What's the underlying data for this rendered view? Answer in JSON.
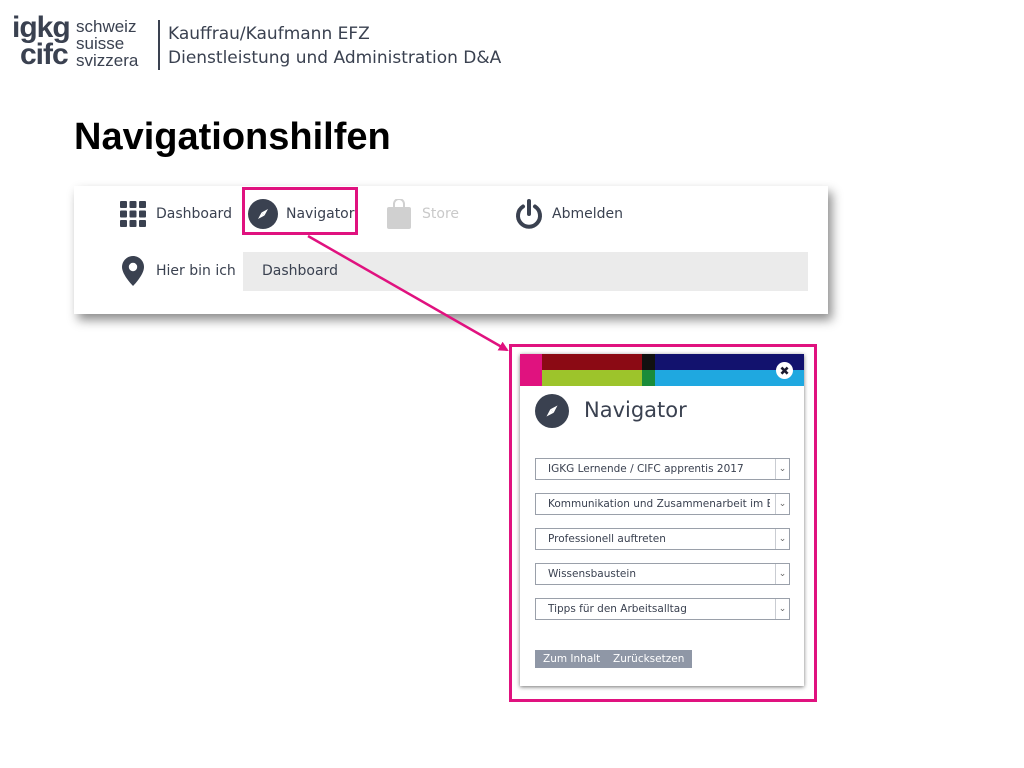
{
  "logo": {
    "main": [
      "igkg",
      "cifc"
    ],
    "sub": [
      "schweiz",
      "suisse",
      "svizzera"
    ]
  },
  "header": {
    "line1": "Kauffrau/Kaufmann EFZ",
    "line2": "Dienstleistung und Administration D&A"
  },
  "page_title": "Navigationshilfen",
  "topbar": {
    "items": [
      {
        "label": "Dashboard",
        "icon": "grid-icon"
      },
      {
        "label": "Navigator",
        "icon": "compass-icon"
      },
      {
        "label": "Store",
        "icon": "shopping-bag-icon"
      },
      {
        "label": "Abmelden",
        "icon": "power-icon"
      }
    ],
    "location_label": "Hier bin ich",
    "location_icon": "map-pin-icon",
    "breadcrumb": "Dashboard"
  },
  "dialog": {
    "title": "Navigator",
    "close_icon": "close-icon",
    "selects": [
      "IGKG Lernende / CIFC apprentis 2017",
      "Kommunikation und Zusammenarbeit im Betrieb",
      "Professionell auftreten",
      "Wissensbaustein",
      "Tipps für den Arbeitsalltag"
    ],
    "buttons": {
      "to_content": "Zum Inhalt",
      "reset": "Zurücksetzen"
    }
  },
  "colors": {
    "highlight": "#e0127f",
    "text": "#3a4150",
    "stripe_magenta": "#e0127f",
    "stripe_darkred": "#8b0a14",
    "stripe_black": "#111111",
    "stripe_navy": "#12126e",
    "stripe_green": "#9dc42b",
    "stripe_darkgreen": "#1a8c3a",
    "stripe_lightblue": "#1fa8e0",
    "button_bg": "#8f97a6"
  }
}
